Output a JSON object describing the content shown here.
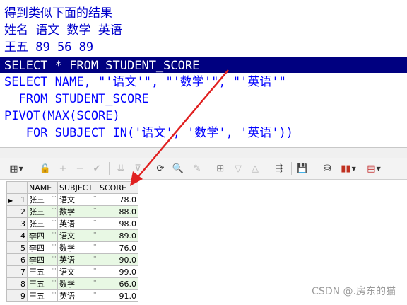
{
  "editor": {
    "comment_lines": [
      "得到类似下面的结果",
      "姓名 语文 数学 英语",
      "王五 89 56 89"
    ],
    "sql_lines": [
      "SELECT * FROM STUDENT_SCORE",
      "SELECT NAME, \"'语文'\", \"'数学'\", \"'英语'\"",
      "  FROM STUDENT_SCORE",
      "PIVOT(MAX(SCORE)",
      "   FOR SUBJECT IN('语文', '数学', '英语'))"
    ]
  },
  "toolbar": {
    "icons": [
      "grid-view-icon",
      "lock-icon",
      "add-row-icon",
      "delete-row-icon",
      "post-icon",
      "filter-down-icon",
      "filter-icon",
      "refresh-icon",
      "find-icon",
      "clear-icon",
      "query-by-example-icon",
      "sort-down-icon",
      "sort-up-icon",
      "connect-icon",
      "save-icon",
      "export-icon",
      "chart-icon",
      "table-icon"
    ]
  },
  "grid": {
    "columns": [
      "NAME",
      "SUBJECT",
      "SCORE"
    ],
    "rows": [
      {
        "n": "1",
        "name": "张三",
        "subject": "语文",
        "score": "78.0"
      },
      {
        "n": "2",
        "name": "张三",
        "subject": "数学",
        "score": "88.0"
      },
      {
        "n": "3",
        "name": "张三",
        "subject": "英语",
        "score": "98.0"
      },
      {
        "n": "4",
        "name": "李四",
        "subject": "语文",
        "score": "89.0"
      },
      {
        "n": "5",
        "name": "李四",
        "subject": "数学",
        "score": "76.0"
      },
      {
        "n": "6",
        "name": "李四",
        "subject": "英语",
        "score": "90.0"
      },
      {
        "n": "7",
        "name": "王五",
        "subject": "语文",
        "score": "99.0"
      },
      {
        "n": "8",
        "name": "王五",
        "subject": "数学",
        "score": "66.0"
      },
      {
        "n": "9",
        "name": "王五",
        "subject": "英语",
        "score": "91.0"
      }
    ]
  },
  "watermark": "CSDN @.房东的猫",
  "colors": {
    "selection": "#000080",
    "keyword": "#0000ff",
    "alt_row": "#e8f8e4",
    "arrow": "#e02020"
  }
}
